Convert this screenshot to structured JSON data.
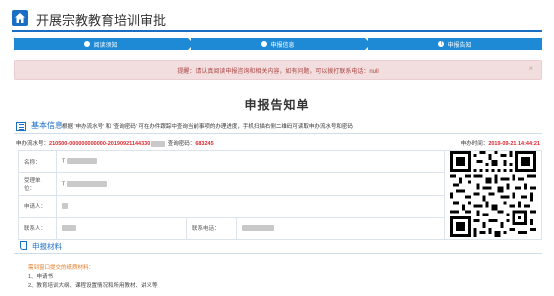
{
  "header": {
    "title": "开展宗教教育培训审批"
  },
  "steps": [
    {
      "label": "阅读须知",
      "marker": ""
    },
    {
      "label": "申报信息",
      "marker": ""
    },
    {
      "label": "申报告知",
      "marker": "!"
    }
  ],
  "alert": {
    "text": "提醒：请认真阅读申报咨询和相关内容，如有问题，可以拨打联系电话：null",
    "close": "×"
  },
  "page_title": "申报告知单",
  "basic": {
    "label": "基本信息",
    "hint": "根据 '申办流水号' 和 '查询密码' 可在办件跟踪中查询当前事项的办理进度，手机扫描右侧二维码可读取申办流水号和密码"
  },
  "meta": {
    "serial_label": "申办流水号：",
    "serial_value": "210500-000000000000-20190921144330",
    "password_label": "查询密码：",
    "password_value": "683245",
    "time_label": "申办时间：",
    "time_value": "2019-09-21 14:44:21"
  },
  "form": {
    "name_label": "名称：",
    "name_value": "T",
    "unit_label": "受理单位：",
    "unit_value": "T",
    "applicant_label": "申请人：",
    "contact_label": "联系人：",
    "phone_label": "联系电话："
  },
  "materials": {
    "label": "申报材料",
    "intro": "需到窗口提交的纸质材料：",
    "items": [
      "1、申请书",
      "2、教育培训大纲、课程设置情况和所用教材、讲义等"
    ]
  }
}
